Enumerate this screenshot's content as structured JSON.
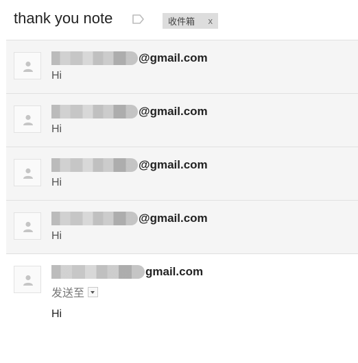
{
  "subject": {
    "title": "thank you note",
    "label_icon": "label-outline-icon",
    "inbox_chip": {
      "label": "收件箱",
      "close": "x"
    }
  },
  "messages": [
    {
      "sender_domain": "@gmail.com",
      "snippet": "Hi",
      "avatar_icon": "person-icon"
    },
    {
      "sender_domain": "@gmail.com",
      "snippet": "Hi",
      "avatar_icon": "person-icon"
    },
    {
      "sender_domain": "@gmail.com",
      "snippet": "Hi",
      "avatar_icon": "person-icon"
    },
    {
      "sender_domain": "@gmail.com",
      "snippet": "Hi",
      "avatar_icon": "person-icon"
    }
  ],
  "expanded_message": {
    "sender_domain": "gmail.com",
    "sent_to": "发送至",
    "body": "Hi",
    "avatar_icon": "person-icon"
  },
  "colors": {
    "collapsed_bg": "#f5f5f5",
    "divider": "#e0e0e0",
    "chip_bg": "#dddddd"
  }
}
